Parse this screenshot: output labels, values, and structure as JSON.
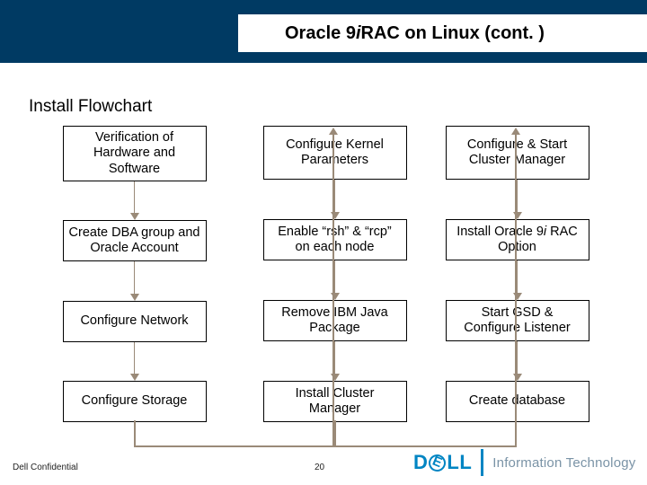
{
  "title": {
    "pre": "Oracle 9",
    "italic": "i",
    "post": " RAC on Linux (cont. )"
  },
  "subtitle": "Install Flowchart",
  "columns": [
    [
      "Verification of Hardware and Software",
      "Create DBA group and Oracle Account",
      "Configure Network",
      "Configure Storage"
    ],
    [
      "Configure Kernel Parameters",
      "Enable “rsh” & “rcp” on each node",
      "Remove IBM Java Package",
      "Install Cluster Manager"
    ],
    [
      "Configure & Start Cluster Manager",
      "__ORACLE9I_RAC__",
      "Start GSD & Configure Listener",
      "Create database"
    ]
  ],
  "special": {
    "oracle9i_pre": "Install Oracle 9",
    "oracle9i_i": "i",
    "oracle9i_post": " RAC Option"
  },
  "footer": {
    "confidential": "Dell Confidential",
    "page": "20",
    "brand_it": "Information Technology"
  }
}
